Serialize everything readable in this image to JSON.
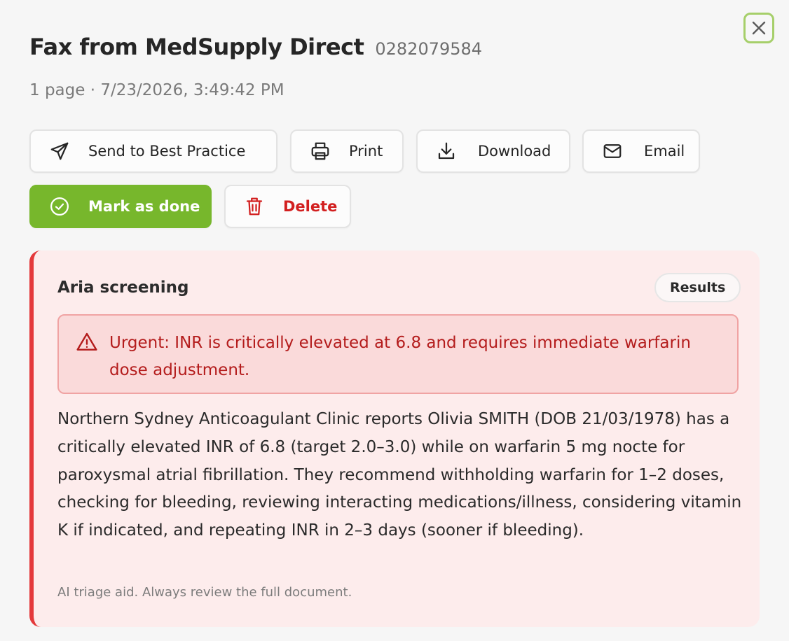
{
  "header": {
    "title": "Fax from MedSupply Direct",
    "fax_number": "0282079584",
    "meta": "1 page · 7/23/2026, 3:49:42 PM"
  },
  "toolbar": {
    "send_label": "Send to Best Practice",
    "print_label": "Print",
    "download_label": "Download",
    "email_label": "Email",
    "done_label": "Mark as done",
    "delete_label": "Delete"
  },
  "screening": {
    "title": "Aria screening",
    "results_label": "Results",
    "urgent_message": "Urgent: INR is critically elevated at 6.8 and requires immediate warfarin dose adjustment.",
    "summary": "Northern Sydney Anticoagulant Clinic reports Olivia SMITH (DOB 21/03/1978) has a critically elevated INR of 6.8 (target 2.0–3.0) while on warfarin 5 mg nocte for paroxysmal atrial fibrillation. They recommend withholding warfarin for 1–2 doses, checking for bleeding, reviewing interacting medications/illness, considering vitamin K if indicated, and repeating INR in 2–3 days (sooner if bleeding).",
    "disclaimer": "AI triage aid. Always review the full document."
  },
  "icons": {
    "close": "close-icon",
    "send": "send-icon",
    "print": "printer-icon",
    "download": "download-icon",
    "email": "mail-icon",
    "done": "check-circle-icon",
    "delete": "trash-icon",
    "warning": "warning-triangle-icon"
  },
  "colors": {
    "accent_green": "#77b72c",
    "focus_ring": "#a6cf6a",
    "danger_red": "#d21f1f",
    "alert_border": "#e4393b",
    "alert_background": "#fdecec"
  }
}
